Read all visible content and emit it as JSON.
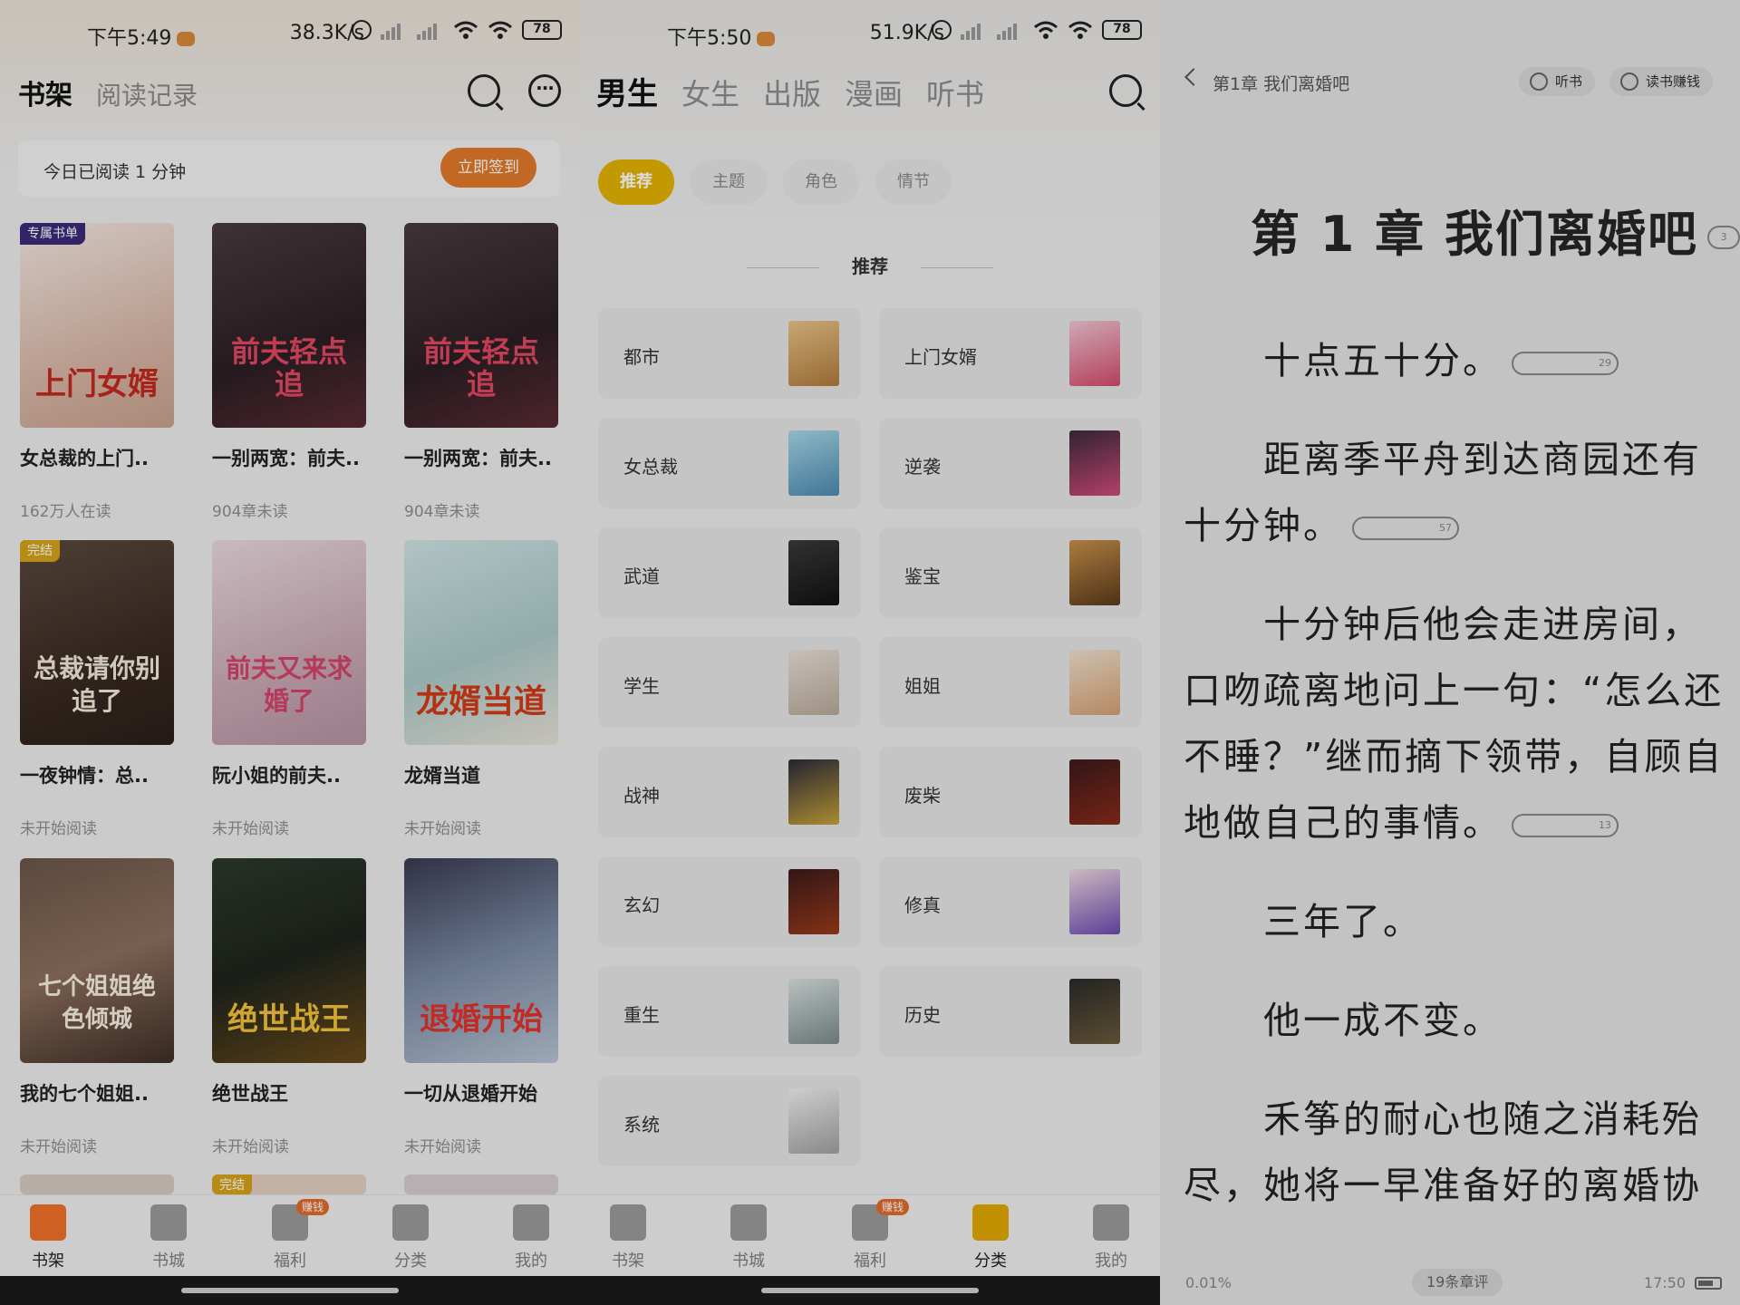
{
  "panels": {
    "bookshelf": {
      "status": {
        "time": "下午5:49",
        "net": "38.3K/s",
        "battery": "78"
      },
      "tabs": {
        "active": "书架",
        "inactive": "阅读记录"
      },
      "signin": {
        "text": "今日已阅读 1 分钟",
        "button": "立即签到"
      },
      "books": [
        {
          "badge": "专属书单",
          "cover_text": "上门女婿",
          "title": "女总裁的上门..",
          "sub": "162万人在读"
        },
        {
          "badge": "",
          "cover_text": "前夫轻点追",
          "title": "一别两宽：前夫..",
          "sub": "904章未读"
        },
        {
          "badge": "",
          "cover_text": "前夫轻点追",
          "title": "一别两宽：前夫..",
          "sub": "904章未读"
        },
        {
          "badge": "完结",
          "cover_text": "总裁请你别追了",
          "title": "一夜钟情：总..",
          "sub": "未开始阅读"
        },
        {
          "badge": "",
          "cover_text": "前夫又来求婚了",
          "title": "阮小姐的前夫..",
          "sub": "未开始阅读"
        },
        {
          "badge": "",
          "cover_text": "龙婿当道",
          "title": "龙婿当道",
          "sub": "未开始阅读"
        },
        {
          "badge": "",
          "cover_text": "七个姐姐绝色倾城",
          "title": "我的七个姐姐..",
          "sub": "未开始阅读"
        },
        {
          "badge": "",
          "cover_text": "绝世战王",
          "title": "绝世战王",
          "sub": "未开始阅读"
        },
        {
          "badge": "",
          "cover_text": "退婚开始",
          "title": "一切从退婚开始",
          "sub": "未开始阅读"
        }
      ],
      "partial_badge": "完结"
    },
    "category": {
      "status": {
        "time": "下午5:50",
        "net": "51.9K/s",
        "battery": "78"
      },
      "tabs": [
        "男生",
        "女生",
        "出版",
        "漫画",
        "听书"
      ],
      "chips": [
        "推荐",
        "主题",
        "角色",
        "情节"
      ],
      "section": "推荐",
      "categories": [
        "都市",
        "上门女婿",
        "女总裁",
        "逆袭",
        "武道",
        "鉴宝",
        "学生",
        "姐姐",
        "战神",
        "废柴",
        "玄幻",
        "修真",
        "重生",
        "历史",
        "系统"
      ]
    },
    "reader": {
      "chapter_short": "第1章 我们离婚吧",
      "listen": "听书",
      "earn": "读书赚钱",
      "chapter_title": "第 1 章 我们离婚吧",
      "title_comments": "3",
      "paragraphs": [
        {
          "text": "十点五十分。",
          "comments": "29"
        },
        {
          "text": "距离季平舟到达商园还有十分钟。",
          "comments": "57"
        },
        {
          "text": "十分钟后他会走进房间，口吻疏离地问上一句：“怎么还不睡？”继而摘下领带，自顾自地做自己的事情。",
          "comments": "13"
        },
        {
          "text": "三年了。",
          "comments": ""
        },
        {
          "text": "他一成不变。",
          "comments": ""
        },
        {
          "text": "禾筝的耐心也随之消耗殆尽，她将一早准备好的离婚协",
          "comments": ""
        }
      ],
      "progress": "0.01%",
      "chapter_comments": "19条章评",
      "clock": "17:50"
    }
  },
  "nav": {
    "items": [
      "书架",
      "书城",
      "福利",
      "分类",
      "我的"
    ],
    "tag": "赚钱"
  },
  "colors": {
    "accent_yellow": "#e2b300",
    "accent_orange": "#e07a2a"
  }
}
